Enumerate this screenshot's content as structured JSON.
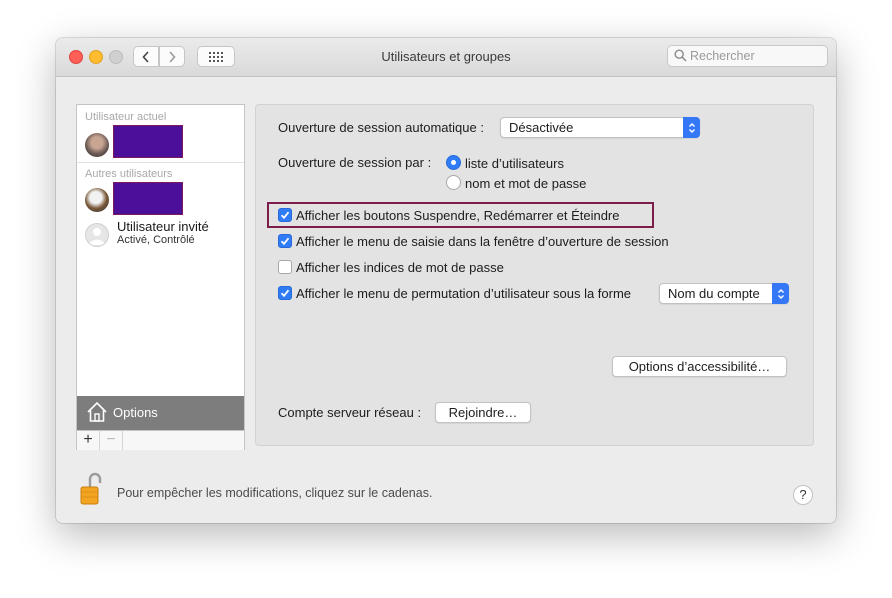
{
  "window": {
    "title": "Utilisateurs et groupes",
    "search_placeholder": "Rechercher"
  },
  "sidebar": {
    "current_header": "Utilisateur actuel",
    "others_header": "Autres utilisateurs",
    "guest": {
      "name": "Utilisateur invité",
      "status": "Activé, Contrôlé"
    },
    "options_label": "Options",
    "add_label": "+",
    "remove_label": "−"
  },
  "main": {
    "auto_login_label": "Ouverture de session automatique :",
    "auto_login_value": "Désactivée",
    "login_window_label": "Ouverture de session par :",
    "radio_list_users": "liste d’utilisateurs",
    "radio_name_password": "nom et mot de passe",
    "cb_sleep_restart": "Afficher les boutons Suspendre, Redémarrer et Éteindre",
    "cb_input_menu": "Afficher le menu de saisie dans la fenêtre d’ouverture de session",
    "cb_password_hints": "Afficher les indices de mot de passe",
    "cb_fast_user_switch": "Afficher le menu de permutation d’utilisateur sous la forme",
    "fast_switch_value": "Nom du compte",
    "accessibility_button": "Options d’accessibilité…",
    "network_account_label": "Compte serveur réseau :",
    "join_button": "Rejoindre…"
  },
  "states": {
    "radio_list_users": true,
    "radio_name_password": false,
    "cb_sleep_restart": true,
    "cb_input_menu": true,
    "cb_password_hints": false,
    "cb_fast_user_switch": true
  },
  "footer": {
    "lock_text": "Pour empêcher les modifications, cliquez sur le cadenas.",
    "help_label": "?"
  },
  "colors": {
    "accent": "#2f7cf6",
    "redaction": "#4b0f9a",
    "highlight_border": "#7b1f4a"
  }
}
